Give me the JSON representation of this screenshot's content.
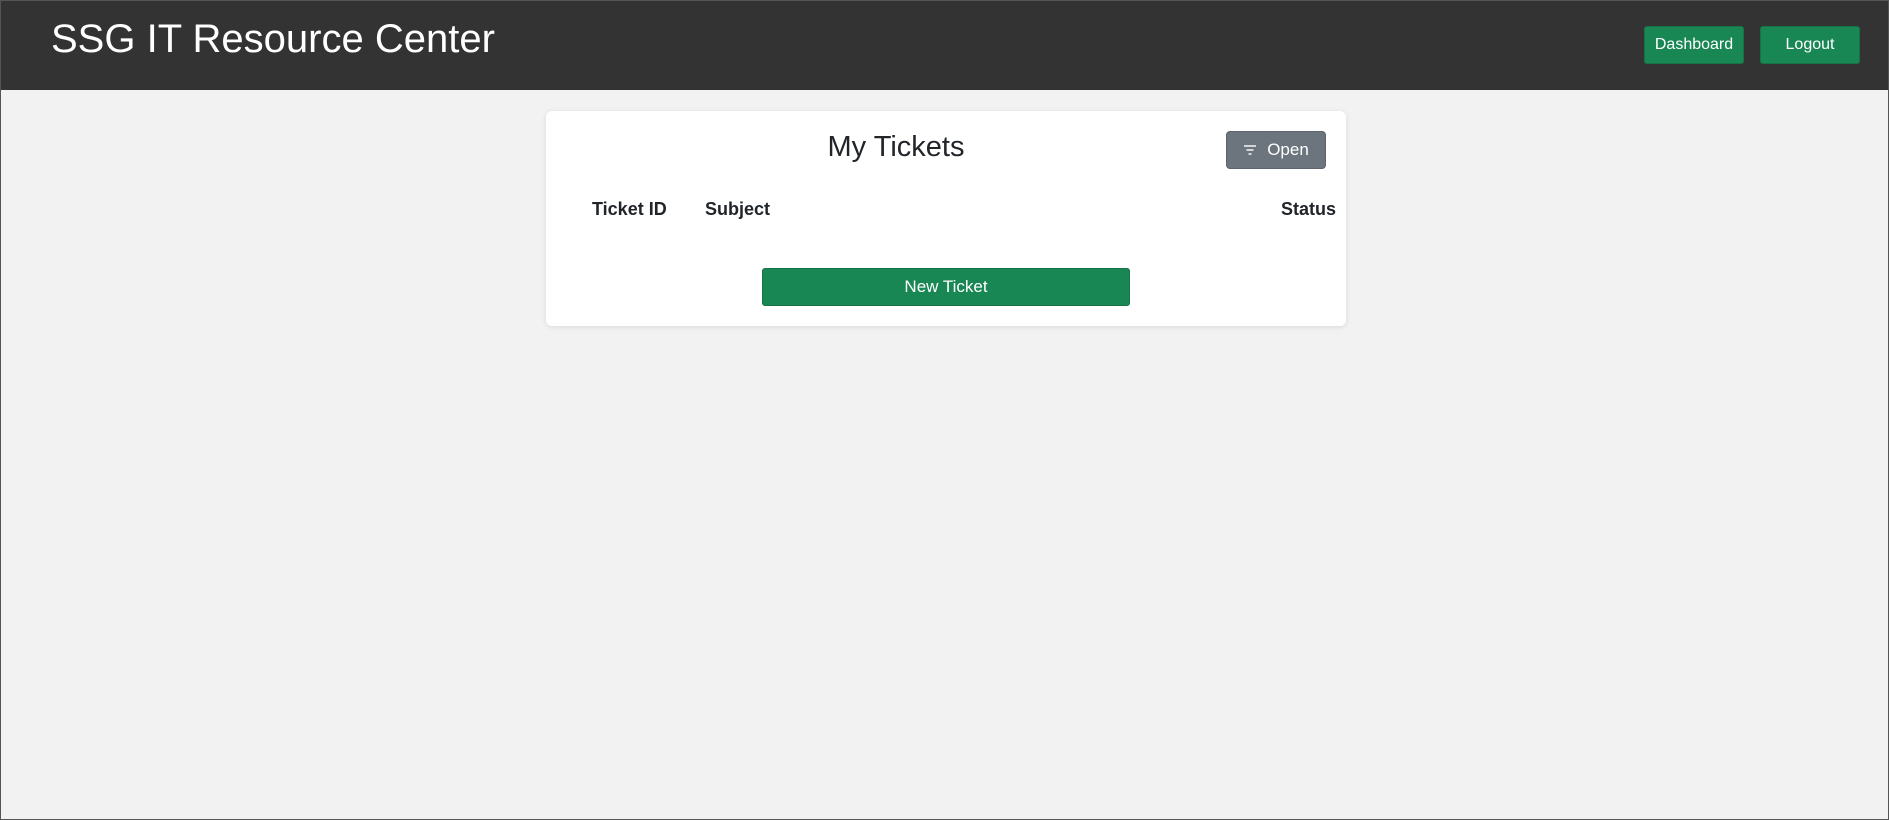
{
  "header": {
    "title": "SSG IT Resource Center",
    "nav": {
      "dashboard_label": "Dashboard",
      "logout_label": "Logout"
    }
  },
  "tickets_card": {
    "title": "My Tickets",
    "filter": {
      "icon": "filter-icon",
      "label": "Open"
    },
    "table": {
      "columns": [
        "Ticket ID",
        "Subject",
        "Status"
      ],
      "rows": []
    },
    "new_ticket_label": "New Ticket"
  },
  "colors": {
    "topbar": "#333333",
    "accent_green": "#198754",
    "filter_gray": "#6c757d",
    "page_bg": "#f2f2f2"
  }
}
